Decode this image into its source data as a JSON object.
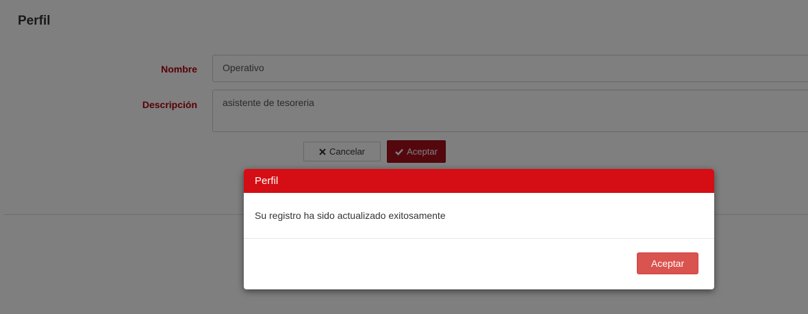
{
  "panel": {
    "title": "Perfil"
  },
  "form": {
    "nombre_label": "Nombre",
    "nombre_value": "Operativo",
    "descripcion_label": "Descripción",
    "descripcion_value": "asistente de tesoreria",
    "cancel_label": "Cancelar",
    "accept_label": "Aceptar"
  },
  "modal": {
    "title": "Perfil",
    "message": "Su registro ha sido actualizado exitosamente",
    "accept_label": "Aceptar"
  },
  "icons": {
    "cancel": "times-icon",
    "accept": "check-icon"
  },
  "colors": {
    "brand_red": "#d40e14",
    "label_red": "#b00010",
    "modal_button": "#d9534f"
  }
}
